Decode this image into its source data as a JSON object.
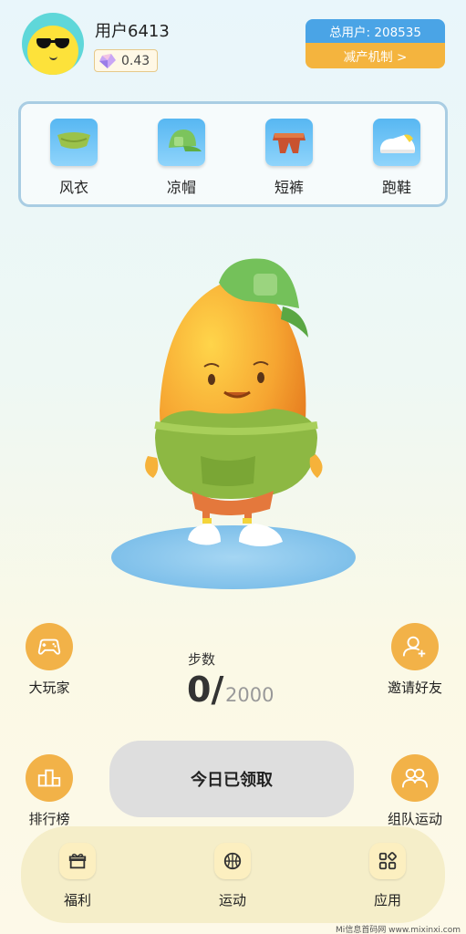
{
  "user": {
    "name": "用户6413",
    "gem_value": "0.43"
  },
  "stats": {
    "total_users": "总用户: 208535",
    "reduction_link": "减产机制 >"
  },
  "closet": [
    {
      "label": "风衣",
      "icon": "hoodie-icon"
    },
    {
      "label": "凉帽",
      "icon": "cap-icon"
    },
    {
      "label": "短裤",
      "icon": "shorts-icon"
    },
    {
      "label": "跑鞋",
      "icon": "sneaker-icon"
    }
  ],
  "side_left": [
    {
      "label": "大玩家",
      "icon": "gamepad-icon"
    },
    {
      "label": "排行榜",
      "icon": "podium-icon"
    }
  ],
  "side_right": [
    {
      "label": "邀请好友",
      "icon": "add-user-icon"
    },
    {
      "label": "组队运动",
      "icon": "team-icon"
    }
  ],
  "steps": {
    "label": "步数",
    "current": "0/",
    "goal": "2000"
  },
  "claim": {
    "label": "今日已领取"
  },
  "nav": [
    {
      "label": "福利",
      "icon": "gift-icon"
    },
    {
      "label": "运动",
      "icon": "basketball-icon"
    },
    {
      "label": "应用",
      "icon": "apps-icon"
    }
  ],
  "watermark": "Mi信息首码网 www.mixinxi.com",
  "colors": {
    "accent_orange": "#f2b248",
    "accent_blue": "#4aa4e6",
    "panel_border": "#a9cde3"
  }
}
